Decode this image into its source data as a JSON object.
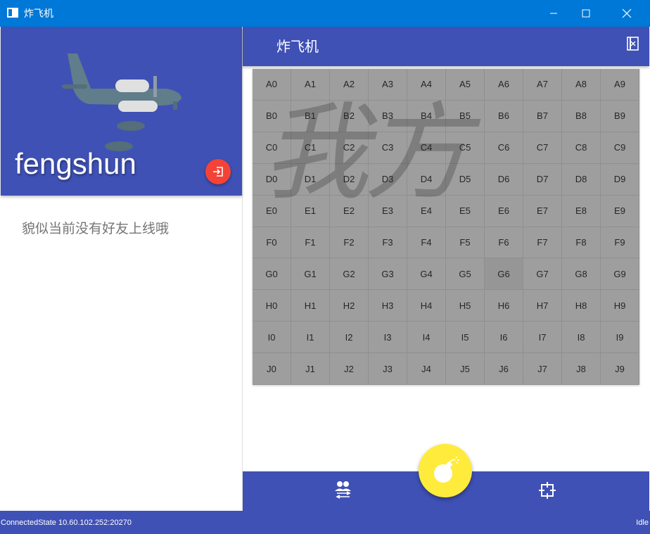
{
  "window": {
    "title": "炸飞机"
  },
  "sidebar": {
    "username": "fengshun",
    "empty_message": "貌似当前没有好友上线哦"
  },
  "main": {
    "title": "炸飞机",
    "watermark": "我方",
    "rows": [
      "A",
      "B",
      "C",
      "D",
      "E",
      "F",
      "G",
      "H",
      "I",
      "J"
    ],
    "cols": [
      "0",
      "1",
      "2",
      "3",
      "4",
      "5",
      "6",
      "7",
      "8",
      "9"
    ],
    "highlighted_cell": "G6"
  },
  "status": {
    "connection": "ConnectedState 10.60.102.252:20270",
    "state": "Idle"
  },
  "icons": {
    "app": "app-window-icon",
    "logout": "logout-icon",
    "exit": "exit-icon",
    "friends": "swap-people-icon",
    "bomb": "bomb-icon",
    "crosshair": "crosshair-icon"
  },
  "colors": {
    "titlebar": "#0078d7",
    "primary": "#3f51b5",
    "logout_button": "#f44336",
    "bomb_button": "#ffeb3b",
    "board": "#9e9e9e"
  }
}
